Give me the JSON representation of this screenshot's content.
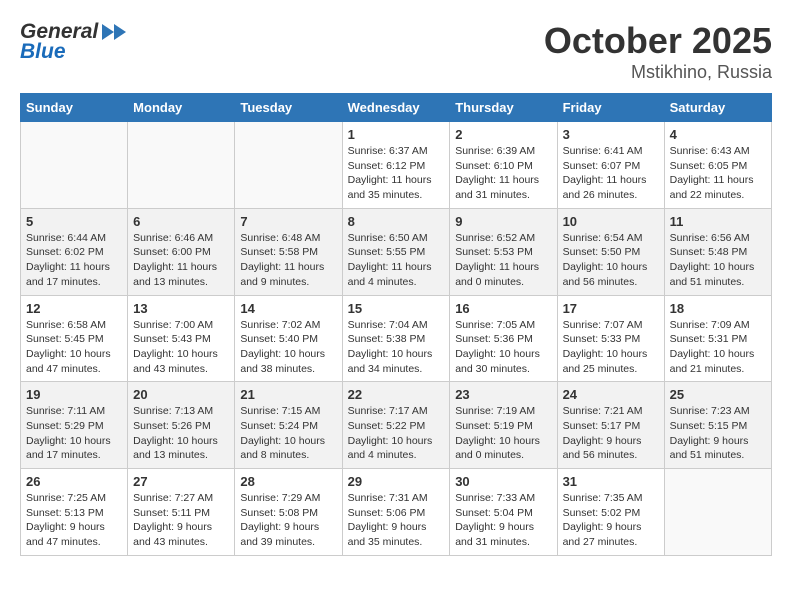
{
  "header": {
    "logo_general": "General",
    "logo_blue": "Blue",
    "title": "October 2025",
    "subtitle": "Mstikhino, Russia"
  },
  "weekdays": [
    "Sunday",
    "Monday",
    "Tuesday",
    "Wednesday",
    "Thursday",
    "Friday",
    "Saturday"
  ],
  "weeks": [
    [
      {
        "day": "",
        "info": ""
      },
      {
        "day": "",
        "info": ""
      },
      {
        "day": "",
        "info": ""
      },
      {
        "day": "1",
        "info": "Sunrise: 6:37 AM\nSunset: 6:12 PM\nDaylight: 11 hours\nand 35 minutes."
      },
      {
        "day": "2",
        "info": "Sunrise: 6:39 AM\nSunset: 6:10 PM\nDaylight: 11 hours\nand 31 minutes."
      },
      {
        "day": "3",
        "info": "Sunrise: 6:41 AM\nSunset: 6:07 PM\nDaylight: 11 hours\nand 26 minutes."
      },
      {
        "day": "4",
        "info": "Sunrise: 6:43 AM\nSunset: 6:05 PM\nDaylight: 11 hours\nand 22 minutes."
      }
    ],
    [
      {
        "day": "5",
        "info": "Sunrise: 6:44 AM\nSunset: 6:02 PM\nDaylight: 11 hours\nand 17 minutes."
      },
      {
        "day": "6",
        "info": "Sunrise: 6:46 AM\nSunset: 6:00 PM\nDaylight: 11 hours\nand 13 minutes."
      },
      {
        "day": "7",
        "info": "Sunrise: 6:48 AM\nSunset: 5:58 PM\nDaylight: 11 hours\nand 9 minutes."
      },
      {
        "day": "8",
        "info": "Sunrise: 6:50 AM\nSunset: 5:55 PM\nDaylight: 11 hours\nand 4 minutes."
      },
      {
        "day": "9",
        "info": "Sunrise: 6:52 AM\nSunset: 5:53 PM\nDaylight: 11 hours\nand 0 minutes."
      },
      {
        "day": "10",
        "info": "Sunrise: 6:54 AM\nSunset: 5:50 PM\nDaylight: 10 hours\nand 56 minutes."
      },
      {
        "day": "11",
        "info": "Sunrise: 6:56 AM\nSunset: 5:48 PM\nDaylight: 10 hours\nand 51 minutes."
      }
    ],
    [
      {
        "day": "12",
        "info": "Sunrise: 6:58 AM\nSunset: 5:45 PM\nDaylight: 10 hours\nand 47 minutes."
      },
      {
        "day": "13",
        "info": "Sunrise: 7:00 AM\nSunset: 5:43 PM\nDaylight: 10 hours\nand 43 minutes."
      },
      {
        "day": "14",
        "info": "Sunrise: 7:02 AM\nSunset: 5:40 PM\nDaylight: 10 hours\nand 38 minutes."
      },
      {
        "day": "15",
        "info": "Sunrise: 7:04 AM\nSunset: 5:38 PM\nDaylight: 10 hours\nand 34 minutes."
      },
      {
        "day": "16",
        "info": "Sunrise: 7:05 AM\nSunset: 5:36 PM\nDaylight: 10 hours\nand 30 minutes."
      },
      {
        "day": "17",
        "info": "Sunrise: 7:07 AM\nSunset: 5:33 PM\nDaylight: 10 hours\nand 25 minutes."
      },
      {
        "day": "18",
        "info": "Sunrise: 7:09 AM\nSunset: 5:31 PM\nDaylight: 10 hours\nand 21 minutes."
      }
    ],
    [
      {
        "day": "19",
        "info": "Sunrise: 7:11 AM\nSunset: 5:29 PM\nDaylight: 10 hours\nand 17 minutes."
      },
      {
        "day": "20",
        "info": "Sunrise: 7:13 AM\nSunset: 5:26 PM\nDaylight: 10 hours\nand 13 minutes."
      },
      {
        "day": "21",
        "info": "Sunrise: 7:15 AM\nSunset: 5:24 PM\nDaylight: 10 hours\nand 8 minutes."
      },
      {
        "day": "22",
        "info": "Sunrise: 7:17 AM\nSunset: 5:22 PM\nDaylight: 10 hours\nand 4 minutes."
      },
      {
        "day": "23",
        "info": "Sunrise: 7:19 AM\nSunset: 5:19 PM\nDaylight: 10 hours\nand 0 minutes."
      },
      {
        "day": "24",
        "info": "Sunrise: 7:21 AM\nSunset: 5:17 PM\nDaylight: 9 hours\nand 56 minutes."
      },
      {
        "day": "25",
        "info": "Sunrise: 7:23 AM\nSunset: 5:15 PM\nDaylight: 9 hours\nand 51 minutes."
      }
    ],
    [
      {
        "day": "26",
        "info": "Sunrise: 7:25 AM\nSunset: 5:13 PM\nDaylight: 9 hours\nand 47 minutes."
      },
      {
        "day": "27",
        "info": "Sunrise: 7:27 AM\nSunset: 5:11 PM\nDaylight: 9 hours\nand 43 minutes."
      },
      {
        "day": "28",
        "info": "Sunrise: 7:29 AM\nSunset: 5:08 PM\nDaylight: 9 hours\nand 39 minutes."
      },
      {
        "day": "29",
        "info": "Sunrise: 7:31 AM\nSunset: 5:06 PM\nDaylight: 9 hours\nand 35 minutes."
      },
      {
        "day": "30",
        "info": "Sunrise: 7:33 AM\nSunset: 5:04 PM\nDaylight: 9 hours\nand 31 minutes."
      },
      {
        "day": "31",
        "info": "Sunrise: 7:35 AM\nSunset: 5:02 PM\nDaylight: 9 hours\nand 27 minutes."
      },
      {
        "day": "",
        "info": ""
      }
    ]
  ]
}
